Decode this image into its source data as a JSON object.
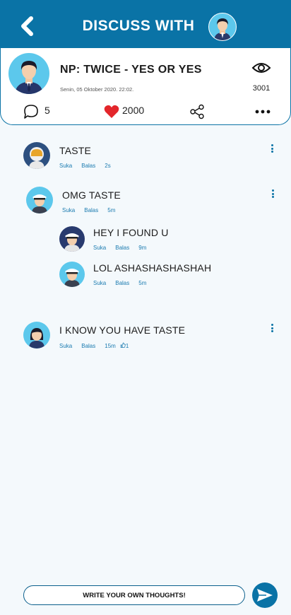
{
  "header": {
    "title": "DISCUSS WITH",
    "back_icon": "back-arrow-icon",
    "avatar": "user-avatar"
  },
  "post": {
    "title": "NP: TWICE - YES OR YES",
    "date": "Senin, 05 Oktober 2020. 22:02.",
    "views": "3001",
    "comments_count": "5",
    "likes_count": "2000"
  },
  "comments": [
    {
      "text": "TASTE",
      "like": "Suka",
      "reply": "Balas",
      "time": "2s"
    },
    {
      "text": "OMG TASTE",
      "like": "Suka",
      "reply": "Balas",
      "time": "5m"
    },
    {
      "text": "HEY I FOUND U",
      "like": "Suka",
      "reply": "Balas",
      "time": "9m"
    },
    {
      "text": "LOL ASHASHASHASHAH",
      "like": "Suka",
      "reply": "Balas",
      "time": "5m"
    },
    {
      "text": "I KNOW YOU HAVE TASTE",
      "like": "Suka",
      "reply": "Balas",
      "time": "15m",
      "likes": "1"
    }
  ],
  "composer": {
    "placeholder": "WRITE YOUR OWN THOUGHTS!"
  },
  "colors": {
    "primary": "#0a73a6",
    "avatar_bg": "#5cc8ec",
    "heart": "#e3262b",
    "meta_text": "#1b7bb0"
  }
}
